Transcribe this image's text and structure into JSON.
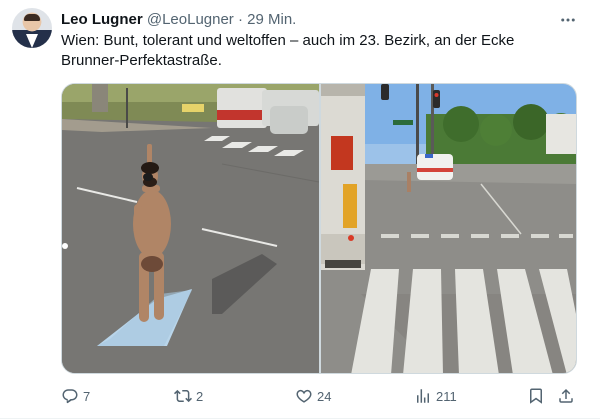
{
  "tweet": {
    "author_name": "Leo Lugner",
    "author_handle": "@LeoLugner",
    "separator": "·",
    "time": "29 Min.",
    "text": "Wien: Bunt, tolerant und weltoffen – auch im 23. Bezirk, an der Ecke Brunner-Perfektastraße.",
    "images": [
      {
        "icon": "street-photo-left"
      },
      {
        "icon": "street-photo-right"
      }
    ]
  },
  "actions": {
    "replies": "7",
    "retweets": "2",
    "likes": "24",
    "views": "211"
  },
  "colors": {
    "text": "#0f1419",
    "secondary": "#536471",
    "border": "#cfd9de"
  }
}
